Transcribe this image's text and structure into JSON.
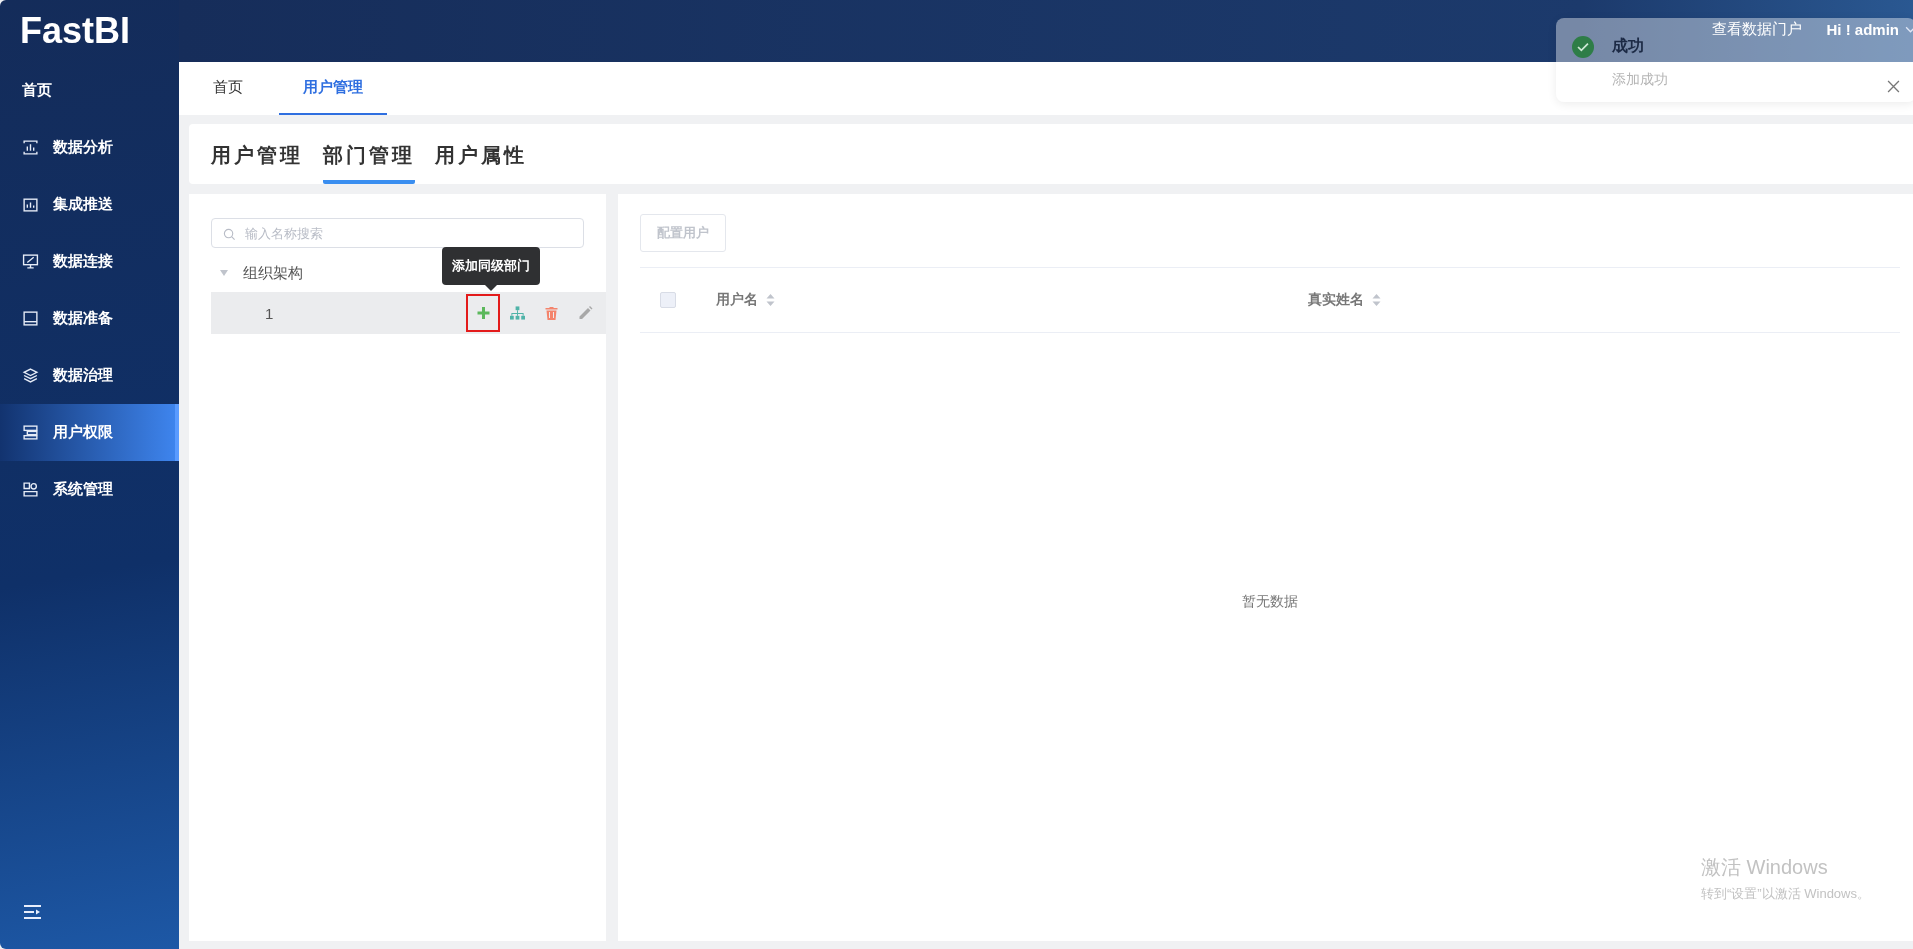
{
  "app": {
    "logo": "FastBI"
  },
  "header": {
    "portal_link": "查看数据门户",
    "user_menu": "Hi ! admin"
  },
  "sidebar": {
    "items": [
      {
        "label": "首页",
        "selected": false
      },
      {
        "label": "数据分析",
        "selected": false
      },
      {
        "label": "集成推送",
        "selected": false
      },
      {
        "label": "数据连接",
        "selected": false
      },
      {
        "label": "数据准备",
        "selected": false
      },
      {
        "label": "数据治理",
        "selected": false
      },
      {
        "label": "用户权限",
        "selected": true
      },
      {
        "label": "系统管理",
        "selected": false
      }
    ]
  },
  "page_tabs": [
    {
      "label": "首页",
      "selected": false
    },
    {
      "label": "用户管理",
      "selected": true
    }
  ],
  "sub_tabs": [
    {
      "label": "用户管理",
      "selected": false
    },
    {
      "label": "部门管理",
      "selected": true
    },
    {
      "label": "用户属性",
      "selected": false
    }
  ],
  "tree": {
    "search": {
      "placeholder": "输入名称搜索"
    },
    "root": {
      "label": "组织架构",
      "expanded": true,
      "children": [
        {
          "label": "1",
          "selected": true,
          "tooltip": "添加同级部门",
          "actions": [
            {
              "kind": "add",
              "highlighted": true
            },
            {
              "kind": "add-child",
              "highlighted": false
            },
            {
              "kind": "delete",
              "highlighted": false
            },
            {
              "kind": "edit",
              "highlighted": false
            }
          ]
        }
      ]
    }
  },
  "users": {
    "button": {
      "label": "配置用户",
      "disabled": true
    },
    "table": {
      "select_all": {
        "checked": false
      },
      "columns": [
        {
          "label": "用户名",
          "sortable": true
        },
        {
          "label": "真实姓名",
          "sortable": true
        }
      ],
      "empty_text": "暂无数据"
    }
  },
  "toast": {
    "title": "成功",
    "message": "添加成功"
  },
  "os_watermark": {
    "title": "激活 Windows",
    "subtitle": "转到“设置”以激活 Windows。"
  }
}
